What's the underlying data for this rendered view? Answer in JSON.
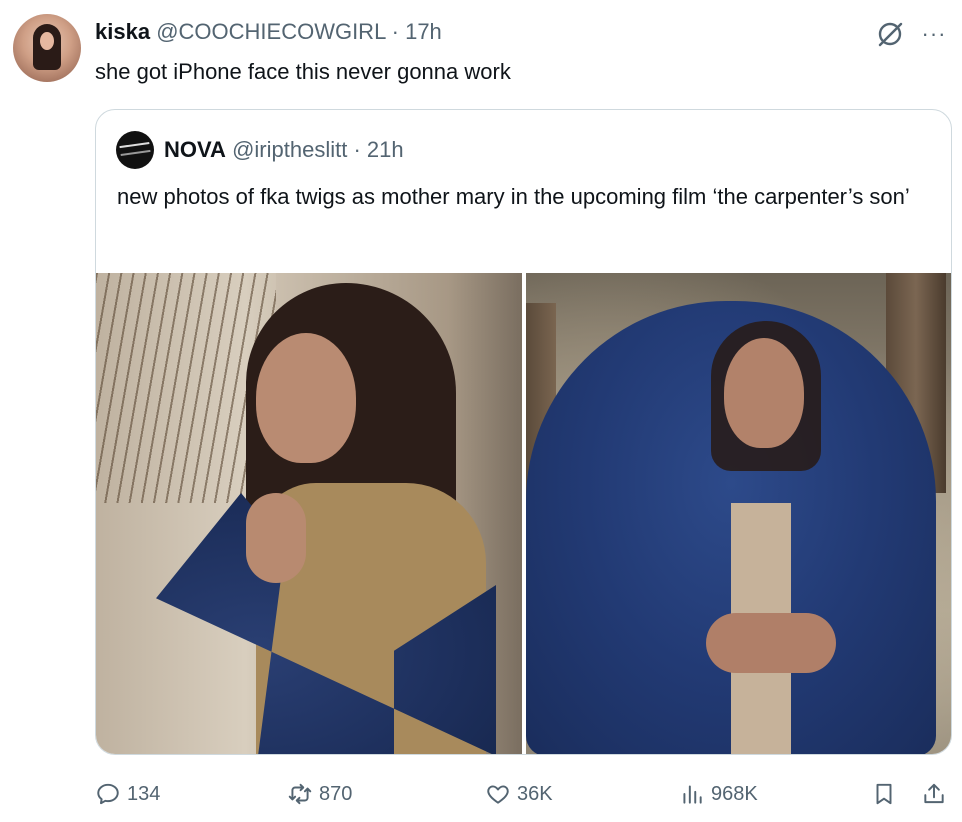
{
  "tweet": {
    "author_name": "kiska",
    "author_handle": "@COOCHIECOWGIRL",
    "time": "17h",
    "text": "she got iPhone face this never gonna work"
  },
  "quoted": {
    "author_name": "NOVA",
    "author_handle": "@iriptheslitt",
    "time": "21h",
    "text": "new photos of fka twigs as mother mary in the upcoming film ‘the carpenter’s son’"
  },
  "actions": {
    "replies": "134",
    "retweets": "870",
    "likes": "36K",
    "views": "968K"
  },
  "icons": {
    "grok": "grok-icon",
    "more": "more-icon",
    "reply": "reply-icon",
    "retweet": "retweet-icon",
    "like": "heart-icon",
    "views": "views-icon",
    "bookmark": "bookmark-icon",
    "share": "share-icon"
  },
  "colors": {
    "text": "#0f1419",
    "secondary": "#536471",
    "border": "#cfd9de"
  }
}
